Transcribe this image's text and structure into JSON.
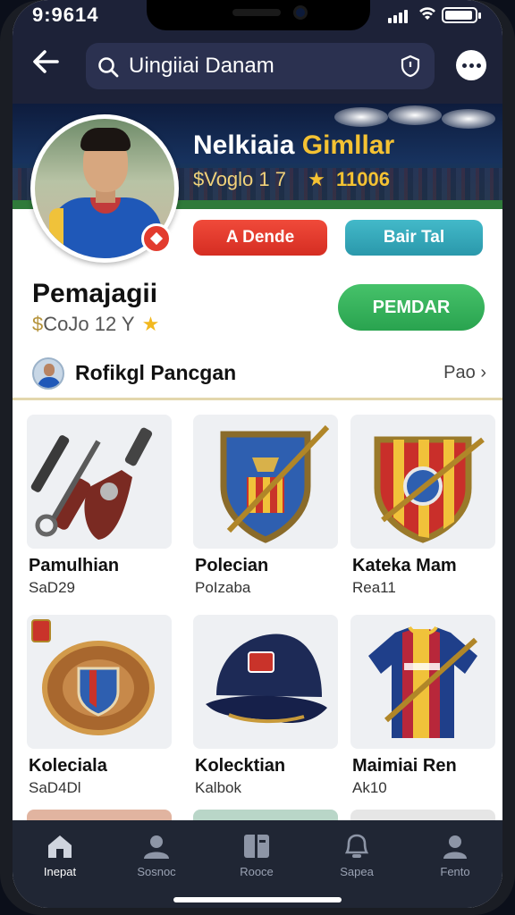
{
  "status": {
    "time": "9:9614"
  },
  "search": {
    "query": "Uingiiai Danam"
  },
  "profile": {
    "name_part1": "Nelkiaia",
    "name_part2": "Gimllar",
    "stats_prefix": "$Voglo 1 7",
    "rating": "11006",
    "button_primary": "A Dende",
    "button_secondary": "Bair Tal"
  },
  "info": {
    "title": "Pemajagii",
    "currency_symbol": "$",
    "subtitle": "CoJo 12 Y",
    "action_label": "PEMDAR"
  },
  "seller_row": {
    "label": "Rofikgl Pancgan",
    "link": "Pao"
  },
  "items": [
    {
      "name": "Pamulhian",
      "price": "SaD29"
    },
    {
      "name": "Polecian",
      "price": "PoIzaba"
    },
    {
      "name": "Kateka Mam",
      "price": "Rea11"
    },
    {
      "name": "Koleciala",
      "price": "SaD4Dl"
    },
    {
      "name": "Kolecktian",
      "price": "Kalbok"
    },
    {
      "name": "Maimiai Ren",
      "price": "Ak10"
    }
  ],
  "tabs": [
    {
      "label": "Inepat",
      "icon": "home-icon"
    },
    {
      "label": "Sosnoc",
      "icon": "search-person-icon"
    },
    {
      "label": "Rooce",
      "icon": "book-icon"
    },
    {
      "label": "Sapea",
      "icon": "bell-icon"
    },
    {
      "label": "Fento",
      "icon": "profile-icon"
    }
  ],
  "colors": {
    "header_bg": "#1d2238",
    "accent_red": "#e23b2e",
    "accent_teal": "#3aaec0",
    "accent_green": "#34b25a",
    "gold": "#f4c233",
    "tabbar_bg": "#202634"
  }
}
